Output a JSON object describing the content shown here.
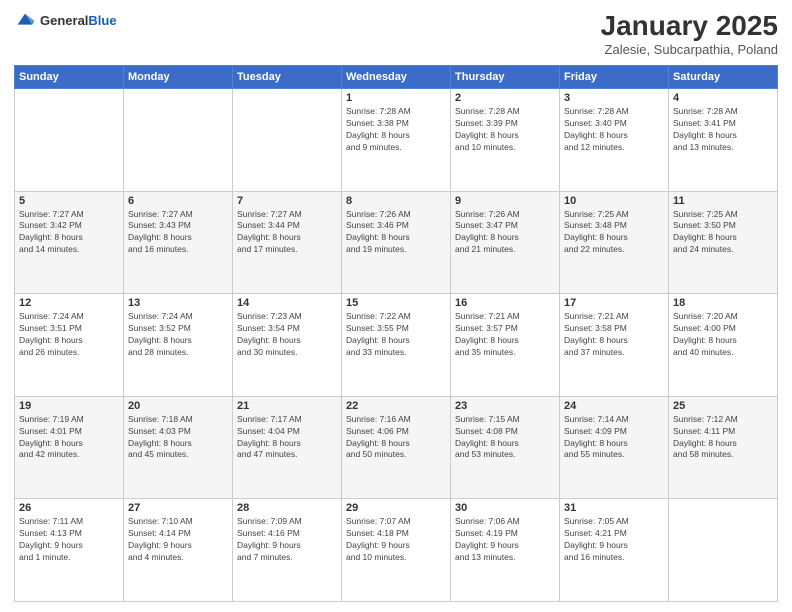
{
  "logo": {
    "general": "General",
    "blue": "Blue"
  },
  "title": "January 2025",
  "location": "Zalesie, Subcarpathia, Poland",
  "weekdays": [
    "Sunday",
    "Monday",
    "Tuesday",
    "Wednesday",
    "Thursday",
    "Friday",
    "Saturday"
  ],
  "weeks": [
    [
      {
        "day": "",
        "info": ""
      },
      {
        "day": "",
        "info": ""
      },
      {
        "day": "",
        "info": ""
      },
      {
        "day": "1",
        "info": "Sunrise: 7:28 AM\nSunset: 3:38 PM\nDaylight: 8 hours\nand 9 minutes."
      },
      {
        "day": "2",
        "info": "Sunrise: 7:28 AM\nSunset: 3:39 PM\nDaylight: 8 hours\nand 10 minutes."
      },
      {
        "day": "3",
        "info": "Sunrise: 7:28 AM\nSunset: 3:40 PM\nDaylight: 8 hours\nand 12 minutes."
      },
      {
        "day": "4",
        "info": "Sunrise: 7:28 AM\nSunset: 3:41 PM\nDaylight: 8 hours\nand 13 minutes."
      }
    ],
    [
      {
        "day": "5",
        "info": "Sunrise: 7:27 AM\nSunset: 3:42 PM\nDaylight: 8 hours\nand 14 minutes."
      },
      {
        "day": "6",
        "info": "Sunrise: 7:27 AM\nSunset: 3:43 PM\nDaylight: 8 hours\nand 16 minutes."
      },
      {
        "day": "7",
        "info": "Sunrise: 7:27 AM\nSunset: 3:44 PM\nDaylight: 8 hours\nand 17 minutes."
      },
      {
        "day": "8",
        "info": "Sunrise: 7:26 AM\nSunset: 3:46 PM\nDaylight: 8 hours\nand 19 minutes."
      },
      {
        "day": "9",
        "info": "Sunrise: 7:26 AM\nSunset: 3:47 PM\nDaylight: 8 hours\nand 21 minutes."
      },
      {
        "day": "10",
        "info": "Sunrise: 7:25 AM\nSunset: 3:48 PM\nDaylight: 8 hours\nand 22 minutes."
      },
      {
        "day": "11",
        "info": "Sunrise: 7:25 AM\nSunset: 3:50 PM\nDaylight: 8 hours\nand 24 minutes."
      }
    ],
    [
      {
        "day": "12",
        "info": "Sunrise: 7:24 AM\nSunset: 3:51 PM\nDaylight: 8 hours\nand 26 minutes."
      },
      {
        "day": "13",
        "info": "Sunrise: 7:24 AM\nSunset: 3:52 PM\nDaylight: 8 hours\nand 28 minutes."
      },
      {
        "day": "14",
        "info": "Sunrise: 7:23 AM\nSunset: 3:54 PM\nDaylight: 8 hours\nand 30 minutes."
      },
      {
        "day": "15",
        "info": "Sunrise: 7:22 AM\nSunset: 3:55 PM\nDaylight: 8 hours\nand 33 minutes."
      },
      {
        "day": "16",
        "info": "Sunrise: 7:21 AM\nSunset: 3:57 PM\nDaylight: 8 hours\nand 35 minutes."
      },
      {
        "day": "17",
        "info": "Sunrise: 7:21 AM\nSunset: 3:58 PM\nDaylight: 8 hours\nand 37 minutes."
      },
      {
        "day": "18",
        "info": "Sunrise: 7:20 AM\nSunset: 4:00 PM\nDaylight: 8 hours\nand 40 minutes."
      }
    ],
    [
      {
        "day": "19",
        "info": "Sunrise: 7:19 AM\nSunset: 4:01 PM\nDaylight: 8 hours\nand 42 minutes."
      },
      {
        "day": "20",
        "info": "Sunrise: 7:18 AM\nSunset: 4:03 PM\nDaylight: 8 hours\nand 45 minutes."
      },
      {
        "day": "21",
        "info": "Sunrise: 7:17 AM\nSunset: 4:04 PM\nDaylight: 8 hours\nand 47 minutes."
      },
      {
        "day": "22",
        "info": "Sunrise: 7:16 AM\nSunset: 4:06 PM\nDaylight: 8 hours\nand 50 minutes."
      },
      {
        "day": "23",
        "info": "Sunrise: 7:15 AM\nSunset: 4:08 PM\nDaylight: 8 hours\nand 53 minutes."
      },
      {
        "day": "24",
        "info": "Sunrise: 7:14 AM\nSunset: 4:09 PM\nDaylight: 8 hours\nand 55 minutes."
      },
      {
        "day": "25",
        "info": "Sunrise: 7:12 AM\nSunset: 4:11 PM\nDaylight: 8 hours\nand 58 minutes."
      }
    ],
    [
      {
        "day": "26",
        "info": "Sunrise: 7:11 AM\nSunset: 4:13 PM\nDaylight: 9 hours\nand 1 minute."
      },
      {
        "day": "27",
        "info": "Sunrise: 7:10 AM\nSunset: 4:14 PM\nDaylight: 9 hours\nand 4 minutes."
      },
      {
        "day": "28",
        "info": "Sunrise: 7:09 AM\nSunset: 4:16 PM\nDaylight: 9 hours\nand 7 minutes."
      },
      {
        "day": "29",
        "info": "Sunrise: 7:07 AM\nSunset: 4:18 PM\nDaylight: 9 hours\nand 10 minutes."
      },
      {
        "day": "30",
        "info": "Sunrise: 7:06 AM\nSunset: 4:19 PM\nDaylight: 9 hours\nand 13 minutes."
      },
      {
        "day": "31",
        "info": "Sunrise: 7:05 AM\nSunset: 4:21 PM\nDaylight: 9 hours\nand 16 minutes."
      },
      {
        "day": "",
        "info": ""
      }
    ]
  ]
}
